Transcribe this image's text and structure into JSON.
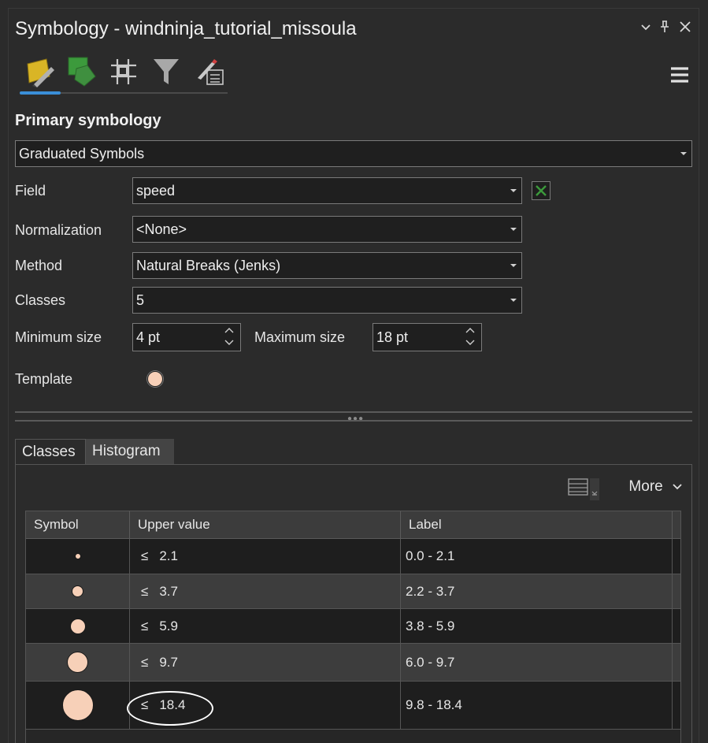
{
  "window": {
    "title": "Symbology - windninja_tutorial_missoula"
  },
  "primary": {
    "section_title": "Primary symbology",
    "type_value": "Graduated Symbols"
  },
  "fields": {
    "field_label": "Field",
    "field_value": "speed",
    "normalization_label": "Normalization",
    "normalization_value": "<None>",
    "method_label": "Method",
    "method_value": "Natural Breaks (Jenks)",
    "classes_label": "Classes",
    "classes_value": "5",
    "min_size_label": "Minimum size",
    "min_size_value": "4 pt",
    "max_size_label": "Maximum size",
    "max_size_value": "18 pt",
    "template_label": "Template"
  },
  "tabs": [
    "Classes",
    "Histogram"
  ],
  "toolbar": {
    "more_label": "More"
  },
  "table": {
    "headers": [
      "Symbol",
      "Upper value",
      "Label"
    ],
    "rows": [
      {
        "le": "≤",
        "upper": "2.1",
        "label": "0.0 - 2.1"
      },
      {
        "le": "≤",
        "upper": "3.7",
        "label": "2.2 - 3.7"
      },
      {
        "le": "≤",
        "upper": "5.9",
        "label": "3.8 - 5.9"
      },
      {
        "le": "≤",
        "upper": "9.7",
        "label": "6.0 - 9.7"
      },
      {
        "le": "≤",
        "upper": "18.4",
        "label": "9.8 - 18.4"
      }
    ]
  },
  "colors": {
    "symbol_fill": "#f7d0b8",
    "accent": "#3a8fd8",
    "excel_green": "#3c9a3c"
  }
}
